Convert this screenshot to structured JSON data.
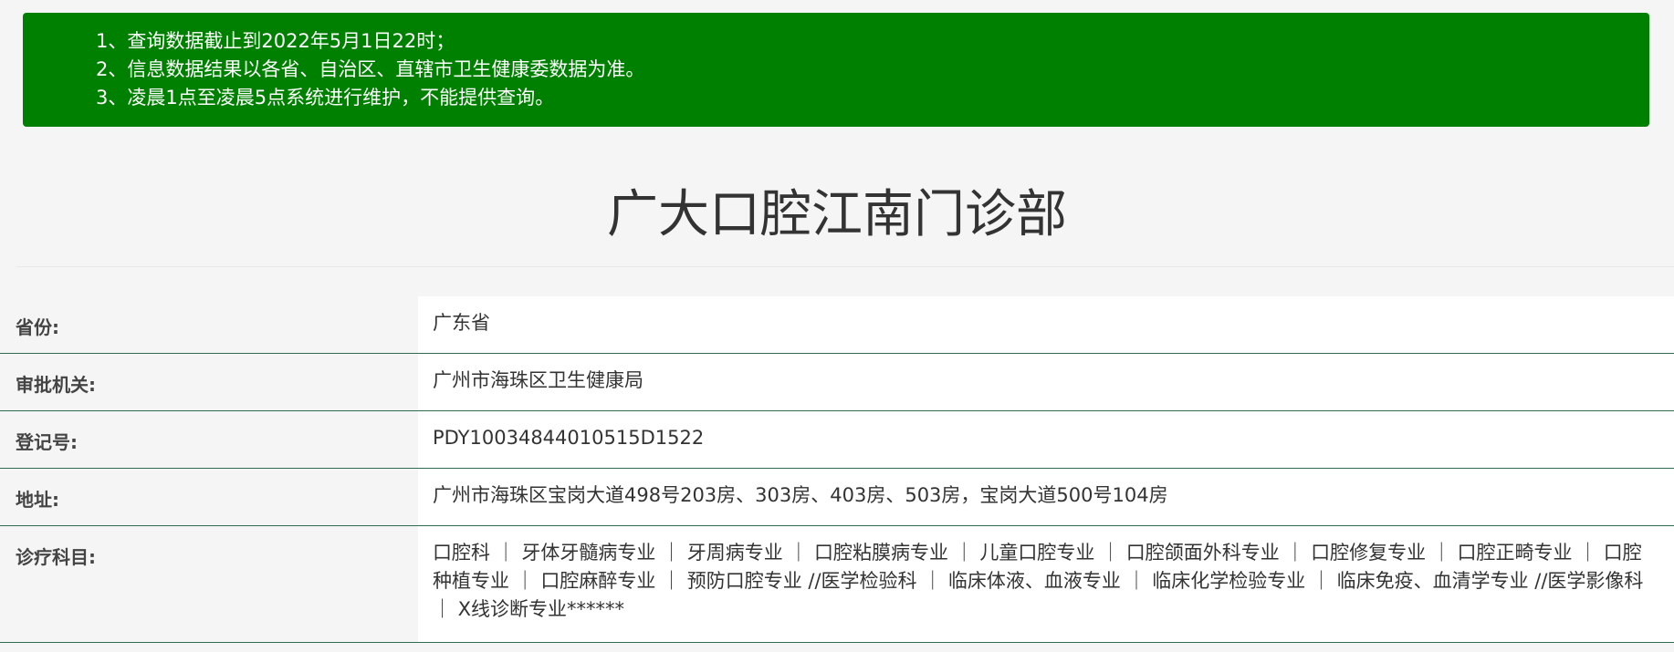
{
  "notice": {
    "lines": [
      "1、查询数据截止到2022年5月1日22时；",
      "2、信息数据结果以各省、自治区、直辖市卫生健康委数据为准。",
      "3、凌晨1点至凌晨5点系统进行维护，不能提供查询。"
    ]
  },
  "page": {
    "title": "广大口腔江南门诊部"
  },
  "info": {
    "rows": [
      {
        "label": "省份:",
        "value": "广东省"
      },
      {
        "label": "审批机关:",
        "value": "广州市海珠区卫生健康局"
      },
      {
        "label": "登记号:",
        "value": "PDY10034844010515D1522"
      },
      {
        "label": "地址:",
        "value": "广州市海珠区宝岗大道498号203房、303房、403房、503房，宝岗大道500号104房"
      },
      {
        "label": "诊疗科目:",
        "value": "口腔科 ｜ 牙体牙髓病专业 ｜ 牙周病专业 ｜ 口腔粘膜病专业 ｜ 儿童口腔专业 ｜ 口腔颌面外科专业 ｜ 口腔修复专业 ｜ 口腔正畸专业 ｜ 口腔种植专业 ｜ 口腔麻醉专业 ｜ 预防口腔专业 //医学检验科 ｜ 临床体液、血液专业 ｜ 临床化学检验专业 ｜ 临床免疫、血清学专业 //医学影像科 ｜ X线诊断专业******"
      }
    ]
  },
  "colors": {
    "notice_bg": "#008000",
    "row_divider": "#2e6b4f",
    "page_bg": "#f5f5f5"
  }
}
